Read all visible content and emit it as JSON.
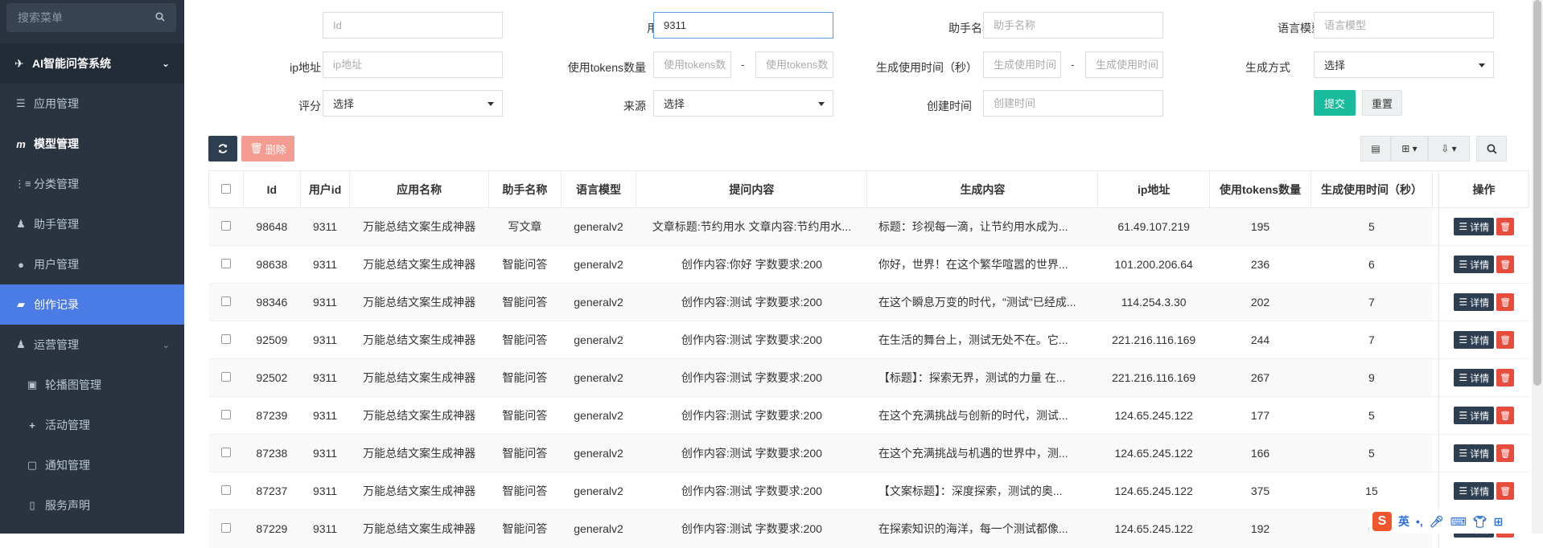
{
  "sidebar": {
    "search_placeholder": "搜索菜单",
    "group_title": "AI智能问答系统",
    "items": [
      {
        "label": "应用管理",
        "icon": "menu-icon"
      },
      {
        "label": "模型管理",
        "icon": "model-icon"
      },
      {
        "label": "分类管理",
        "icon": "category-icon"
      },
      {
        "label": "助手管理",
        "icon": "assistant-icon"
      },
      {
        "label": "用户管理",
        "icon": "user-icon"
      },
      {
        "label": "创作记录",
        "icon": "folder-open-icon"
      },
      {
        "label": "运营管理",
        "icon": "operation-icon"
      },
      {
        "label": "轮播图管理",
        "icon": "image-icon"
      },
      {
        "label": "活动管理",
        "icon": "plus-icon"
      },
      {
        "label": "通知管理",
        "icon": "notice-icon"
      },
      {
        "label": "服务声明",
        "icon": "document-icon"
      }
    ]
  },
  "filters": {
    "id_label": "Id",
    "id_placeholder": "Id",
    "userid_label": "用户id",
    "userid_value": "9311",
    "assistant_label": "助手名称",
    "assistant_placeholder": "助手名称",
    "model_label": "语言模型",
    "model_placeholder": "语言模型",
    "ip_label": "ip地址",
    "ip_placeholder": "ip地址",
    "tokens_label": "使用tokens数量",
    "tokens_placeholder": "使用tokens数",
    "duration_label": "生成使用时间（秒）",
    "duration_placeholder": "生成使用时间",
    "mode_label": "生成方式",
    "mode_value": "选择",
    "rating_label": "评分",
    "rating_value": "选择",
    "source_label": "来源",
    "source_value": "选择",
    "created_label": "创建时间",
    "created_placeholder": "创建时间",
    "dash": "-",
    "submit": "提交",
    "reset": "重置"
  },
  "toolbar": {
    "delete": "删除"
  },
  "table": {
    "headers": [
      "Id",
      "用户id",
      "应用名称",
      "助手名称",
      "语言模型",
      "提问内容",
      "生成内容",
      "ip地址",
      "使用tokens数量",
      "生成使用时间（秒）",
      "操作"
    ],
    "detail_label": "详情",
    "rows": [
      {
        "id": "98648",
        "uid": "9311",
        "app": "万能总结文案生成神器",
        "assistant": "写文章",
        "model": "generalv2",
        "question": "文章标题:节约用水 文章内容:节约用水...",
        "content": "标题：珍视每一滴，让节约用水成为...",
        "ip": "61.49.107.219",
        "tokens": "195",
        "time": "5"
      },
      {
        "id": "98638",
        "uid": "9311",
        "app": "万能总结文案生成神器",
        "assistant": "智能问答",
        "model": "generalv2",
        "question": "创作内容:你好 字数要求:200",
        "content": "你好，世界！在这个繁华喧嚣的世界...",
        "ip": "101.200.206.64",
        "tokens": "236",
        "time": "6"
      },
      {
        "id": "98346",
        "uid": "9311",
        "app": "万能总结文案生成神器",
        "assistant": "智能问答",
        "model": "generalv2",
        "question": "创作内容:测试 字数要求:200",
        "content": "在这个瞬息万变的时代，\"测试\"已经成...",
        "ip": "114.254.3.30",
        "tokens": "202",
        "time": "7"
      },
      {
        "id": "92509",
        "uid": "9311",
        "app": "万能总结文案生成神器",
        "assistant": "智能问答",
        "model": "generalv2",
        "question": "创作内容:测试 字数要求:200",
        "content": "在生活的舞台上，测试无处不在。它...",
        "ip": "221.216.116.169",
        "tokens": "244",
        "time": "7"
      },
      {
        "id": "92502",
        "uid": "9311",
        "app": "万能总结文案生成神器",
        "assistant": "智能问答",
        "model": "generalv2",
        "question": "创作内容:测试 字数要求:200",
        "content": "【标题】：探索无界，测试的力量 在...",
        "ip": "221.216.116.169",
        "tokens": "267",
        "time": "9"
      },
      {
        "id": "87239",
        "uid": "9311",
        "app": "万能总结文案生成神器",
        "assistant": "智能问答",
        "model": "generalv2",
        "question": "创作内容:测试 字数要求:200",
        "content": "在这个充满挑战与创新的时代，测试...",
        "ip": "124.65.245.122",
        "tokens": "177",
        "time": "5"
      },
      {
        "id": "87238",
        "uid": "9311",
        "app": "万能总结文案生成神器",
        "assistant": "智能问答",
        "model": "generalv2",
        "question": "创作内容:测试 字数要求:200",
        "content": "在这个充满挑战与机遇的世界中，测...",
        "ip": "124.65.245.122",
        "tokens": "166",
        "time": "5"
      },
      {
        "id": "87237",
        "uid": "9311",
        "app": "万能总结文案生成神器",
        "assistant": "智能问答",
        "model": "generalv2",
        "question": "创作内容:测试 字数要求:200",
        "content": "【文案标题】：深度探索，测试的奥...",
        "ip": "124.65.245.122",
        "tokens": "375",
        "time": "15"
      },
      {
        "id": "87229",
        "uid": "9311",
        "app": "万能总结文案生成神器",
        "assistant": "智能问答",
        "model": "generalv2",
        "question": "创作内容:测试 字数要求:200",
        "content": "在探索知识的海洋，每一个测试都像...",
        "ip": "124.65.245.122",
        "tokens": "192",
        "time": "6"
      }
    ]
  },
  "ime": {
    "lang": "英"
  },
  "colors": {
    "sidebar_bg": "#2a3340",
    "active": "#4b7be5",
    "submit": "#18bc9c",
    "danger": "#e74c3c",
    "dark_btn": "#2c3e50"
  }
}
